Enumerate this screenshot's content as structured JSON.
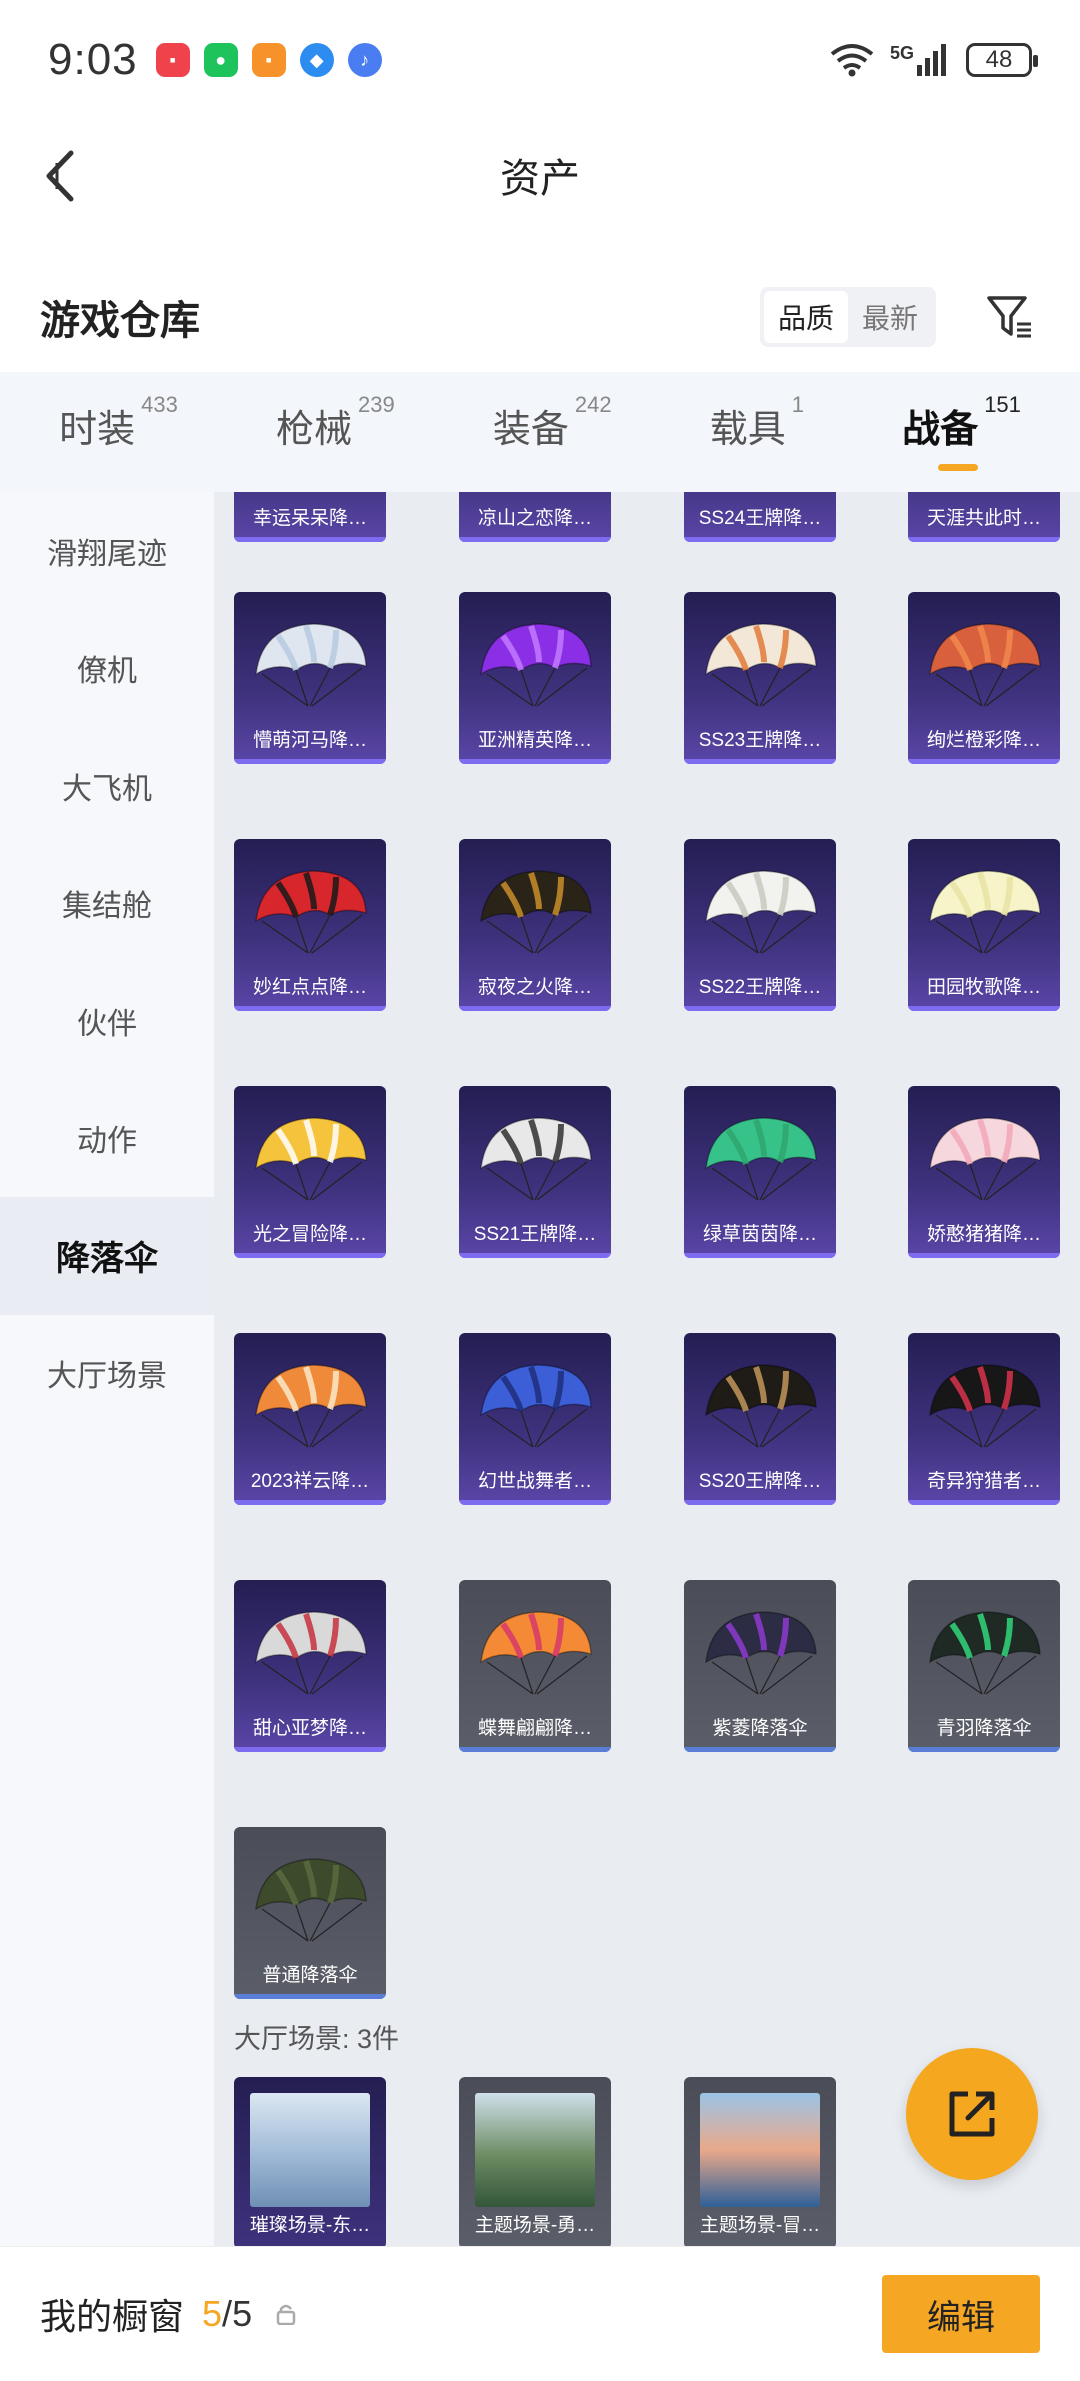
{
  "status_bar": {
    "time": "9:03",
    "network": "5G",
    "battery": "48",
    "app_icons": [
      "shopping-bag-icon",
      "wechat-icon",
      "game-center-icon",
      "browser-icon",
      "music-icon"
    ]
  },
  "header": {
    "title": "资产"
  },
  "warehouse": {
    "title": "游戏仓库",
    "sort_options": [
      "品质",
      "最新"
    ],
    "sort_active": "品质"
  },
  "tabs": [
    {
      "label": "时装",
      "count": "433"
    },
    {
      "label": "枪械",
      "count": "239"
    },
    {
      "label": "装备",
      "count": "242"
    },
    {
      "label": "载具",
      "count": "1"
    },
    {
      "label": "战备",
      "count": "151",
      "active": true
    }
  ],
  "sidebar": {
    "items": [
      "滑翔尾迹",
      "僚机",
      "大飞机",
      "集结舱",
      "伙伴",
      "动作",
      "降落伞",
      "大厅场景"
    ],
    "active": "降落伞"
  },
  "items": {
    "top_partial": [
      "幸运呆呆降…",
      "凉山之恋降…",
      "SS24王牌降…",
      "天涯共此时…"
    ],
    "row1": [
      "懵萌河马降…",
      "亚洲精英降…",
      "SS23王牌降…",
      "绚烂橙彩降…"
    ],
    "row2": [
      "妙红点点降…",
      "寂夜之火降…",
      "SS22王牌降…",
      "田园牧歌降…"
    ],
    "row3": [
      "光之冒险降…",
      "SS21王牌降…",
      "绿草茵茵降…",
      "娇憨猪猪降…"
    ],
    "row4": [
      "2023祥云降…",
      "幻世战舞者…",
      "SS20王牌降…",
      "奇异狩猎者…"
    ],
    "row5": [
      "甜心亚梦降…",
      "蝶舞翩翩降…",
      "紫菱降落伞",
      "青羽降落伞"
    ],
    "row6": [
      "普通降落伞"
    ]
  },
  "lobby_section": {
    "label": "大厅场景: 3件",
    "items": [
      "璀璨场景-东…",
      "主题场景-勇…",
      "主题场景-冒…"
    ]
  },
  "bottom": {
    "label": "我的橱窗",
    "current": "5",
    "separator": "/",
    "total": "5",
    "edit_label": "编辑"
  },
  "colors": {
    "accent": "#f5a623",
    "card_premium": "#3f327e",
    "card_basic": "#565966"
  }
}
